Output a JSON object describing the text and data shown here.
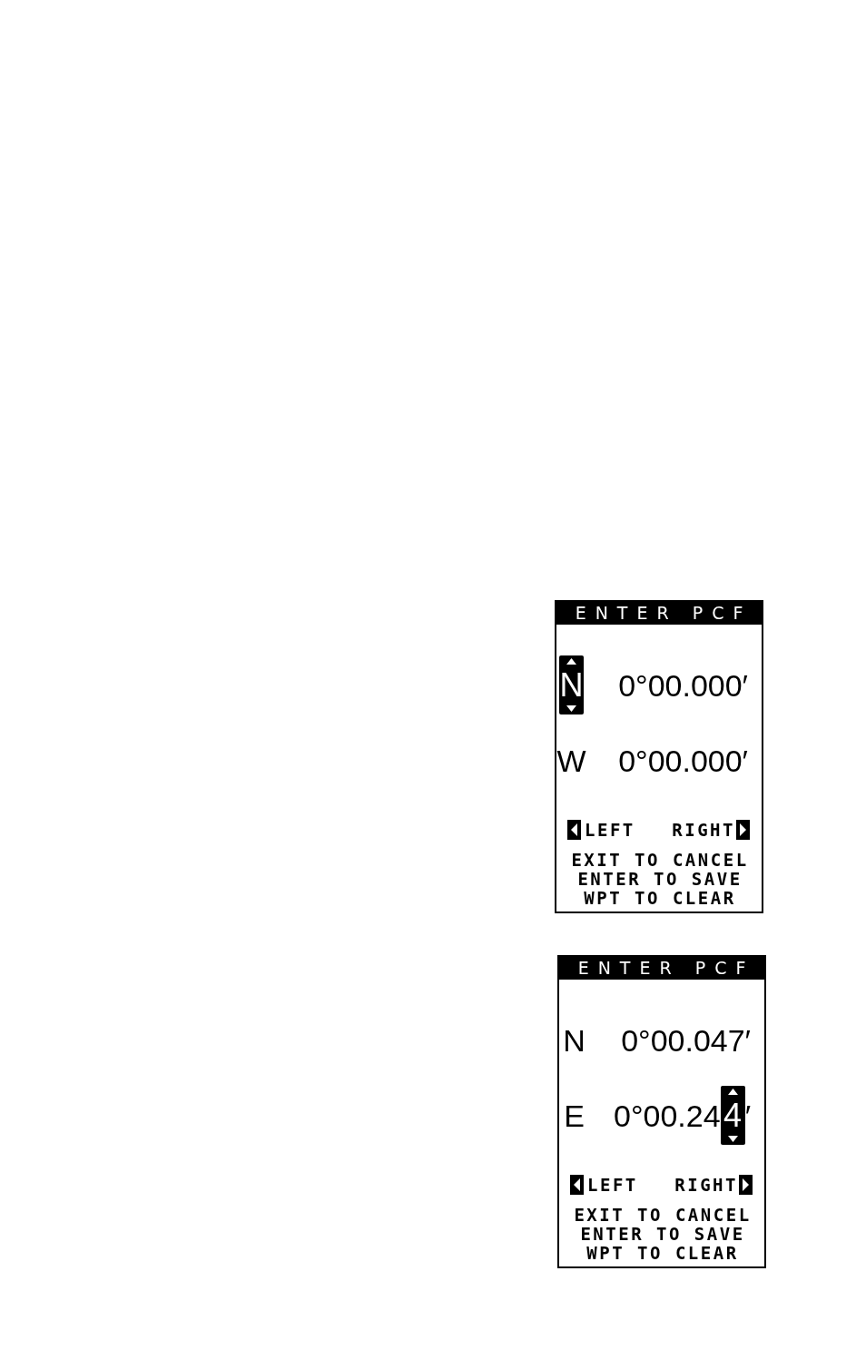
{
  "screens": [
    {
      "title": "ENTER PCF",
      "rows": [
        {
          "hemisphere": {
            "text": "N",
            "selected": true
          },
          "value": [
            {
              "text": "0°00.000′",
              "selected": false
            }
          ]
        },
        {
          "hemisphere": {
            "text": "W",
            "selected": false
          },
          "value": [
            {
              "text": "0°00.000′",
              "selected": false
            }
          ]
        }
      ],
      "nav": {
        "left": "LEFT",
        "right": "RIGHT"
      },
      "instructions": [
        "EXIT TO CANCEL",
        "ENTER TO SAVE",
        "WPT TO CLEAR"
      ]
    },
    {
      "title": "ENTER PCF",
      "rows": [
        {
          "hemisphere": {
            "text": "N",
            "selected": false
          },
          "value": [
            {
              "text": "0°00.047′",
              "selected": false
            }
          ]
        },
        {
          "hemisphere": {
            "text": "E",
            "selected": false
          },
          "value": [
            {
              "text": "0°00.24",
              "selected": false
            },
            {
              "text": "4",
              "selected": true
            },
            {
              "text": "′",
              "selected": false
            }
          ]
        }
      ],
      "nav": {
        "left": "LEFT",
        "right": "RIGHT"
      },
      "instructions": [
        "EXIT TO CANCEL",
        "ENTER TO SAVE",
        "WPT TO CLEAR"
      ]
    }
  ]
}
